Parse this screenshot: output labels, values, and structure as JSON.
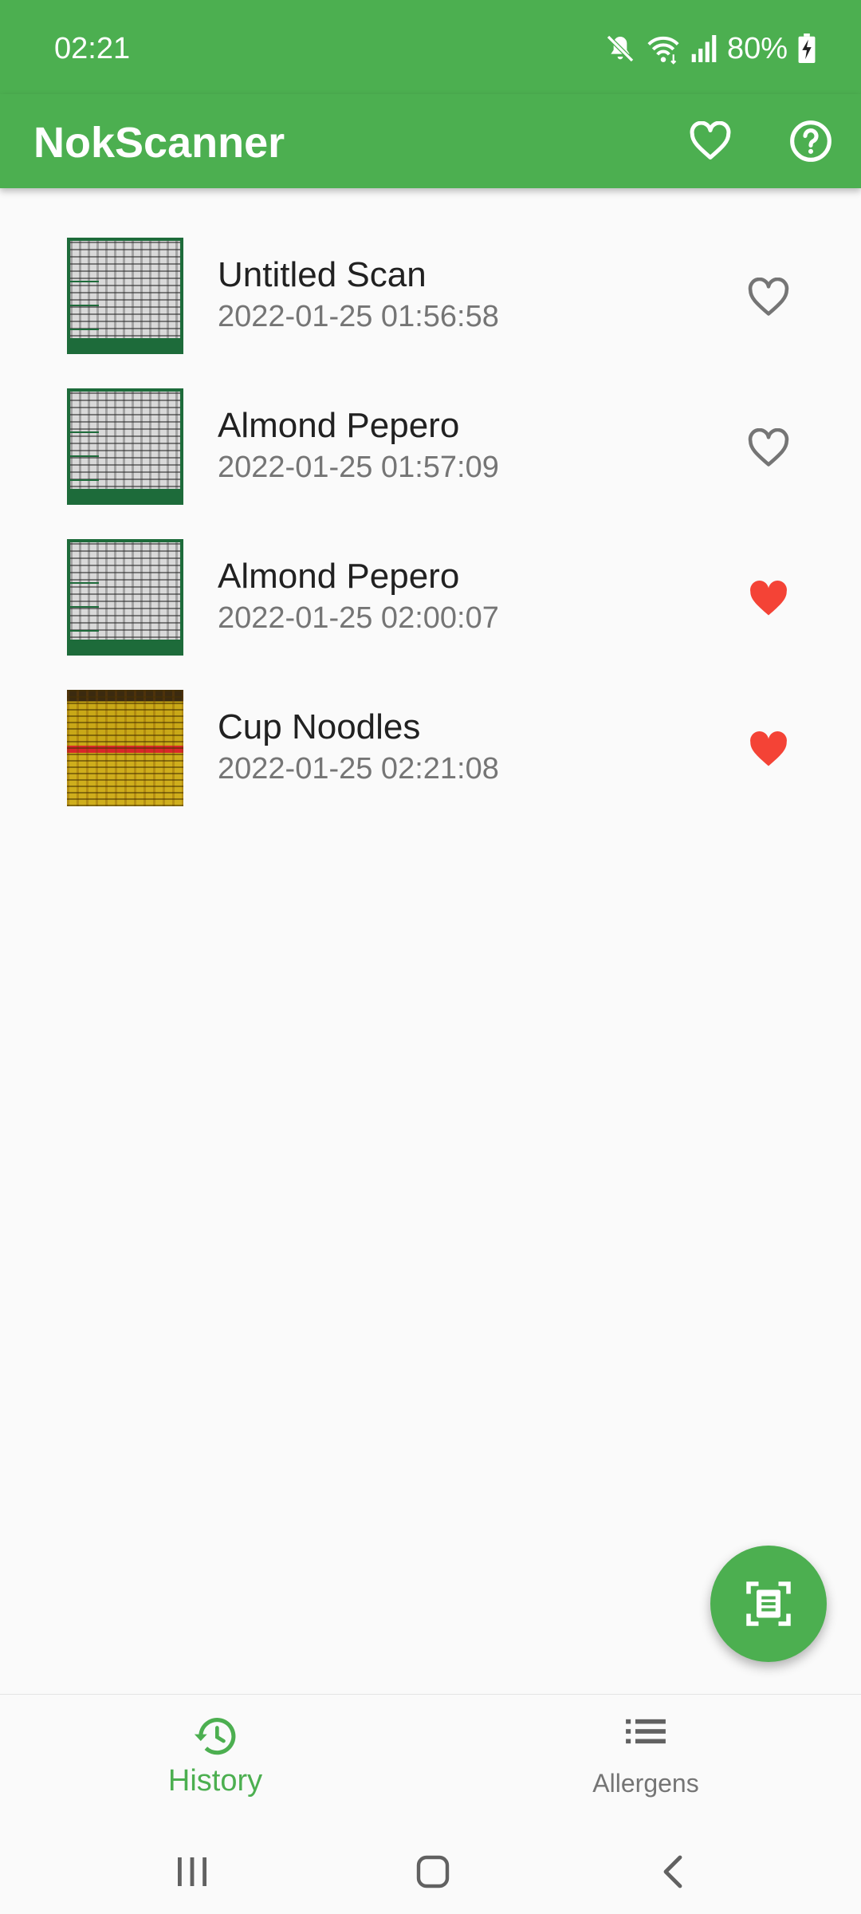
{
  "status_bar": {
    "time": "02:21",
    "battery": "80%",
    "icons": [
      "mute-icon",
      "wifi-icon",
      "signal-icon",
      "battery-charging-icon"
    ]
  },
  "app_bar": {
    "title": "NokScanner",
    "actions": [
      "favorites-heart-icon",
      "help-icon"
    ]
  },
  "scans": [
    {
      "title": "Untitled Scan",
      "date": "2022-01-25 01:56:58",
      "favorite": false,
      "thumbnail": "label-photo"
    },
    {
      "title": "Almond Pepero",
      "date": "2022-01-25 01:57:09",
      "favorite": false,
      "thumbnail": "label-photo"
    },
    {
      "title": "Almond Pepero",
      "date": "2022-01-25 02:00:07",
      "favorite": true,
      "thumbnail": "label-photo"
    },
    {
      "title": "Cup Noodles",
      "date": "2022-01-25 02:21:08",
      "favorite": true,
      "thumbnail": "noodle-label-photo"
    }
  ],
  "fab": {
    "icon": "document-scanner-icon"
  },
  "bottom_nav": {
    "tabs": [
      {
        "label": "History",
        "icon": "history-icon",
        "active": true
      },
      {
        "label": "Allergens",
        "icon": "list-icon",
        "active": false
      }
    ]
  },
  "system_nav": [
    "recents-icon",
    "home-icon",
    "back-icon"
  ],
  "colors": {
    "primary": "#4caf50",
    "favorite_active": "#f44336",
    "favorite_inactive": "#757575",
    "text_primary": "#212121",
    "text_secondary": "#757575",
    "background": "#fafafa"
  }
}
